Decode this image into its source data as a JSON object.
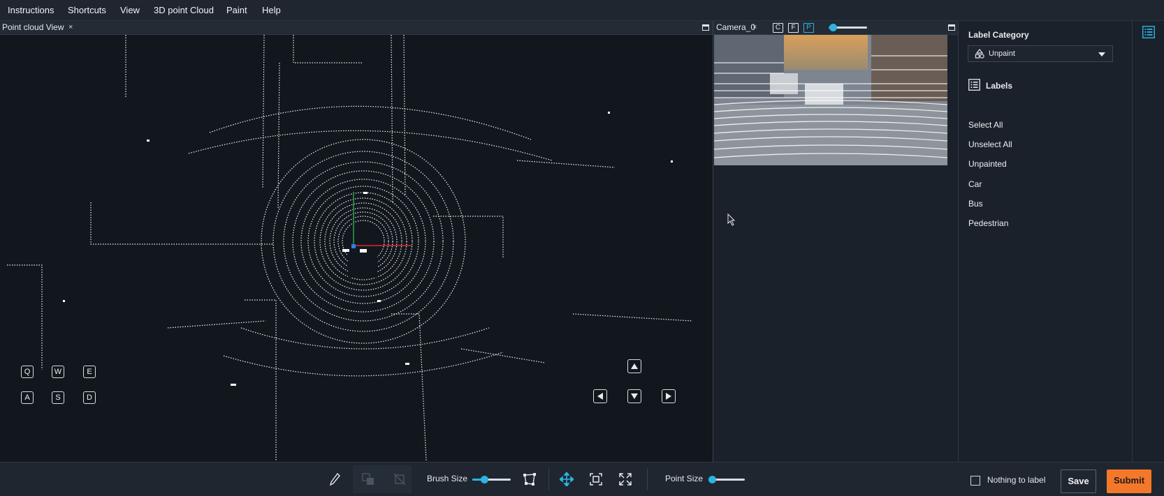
{
  "menu": [
    "Instructions",
    "Shortcuts",
    "View",
    "3D point Cloud",
    "Paint",
    "Help"
  ],
  "point_cloud_panel": {
    "title": "Point cloud View",
    "close": "×",
    "keys_top": [
      "Q",
      "W",
      "E"
    ],
    "keys_bottom": [
      "A",
      "S",
      "D"
    ]
  },
  "camera_panel": {
    "title": "Camera_0",
    "close": "×",
    "view_keys": [
      "C",
      "F",
      "P"
    ],
    "opacity_level": 0.1
  },
  "sidebar": {
    "category_heading": "Label Category",
    "category_selected": "Unpaint",
    "labels_heading": "Labels",
    "items": [
      "Select All",
      "Unselect All",
      "Unpainted",
      "Car",
      "Bus",
      "Pedestrian"
    ]
  },
  "toolbar": {
    "brush_size_label": "Brush Size",
    "brush_size_level": 0.3,
    "point_size_label": "Point Size",
    "point_size_level": 0.05,
    "nothing_to_label": "Nothing to label",
    "save": "Save",
    "submit": "Submit"
  },
  "colors": {
    "accent": "#2bb5e0",
    "submit": "#f5782a",
    "axis_x": "#d62c2c",
    "axis_y": "#2ea043",
    "axis_z": "#2b7de9"
  }
}
